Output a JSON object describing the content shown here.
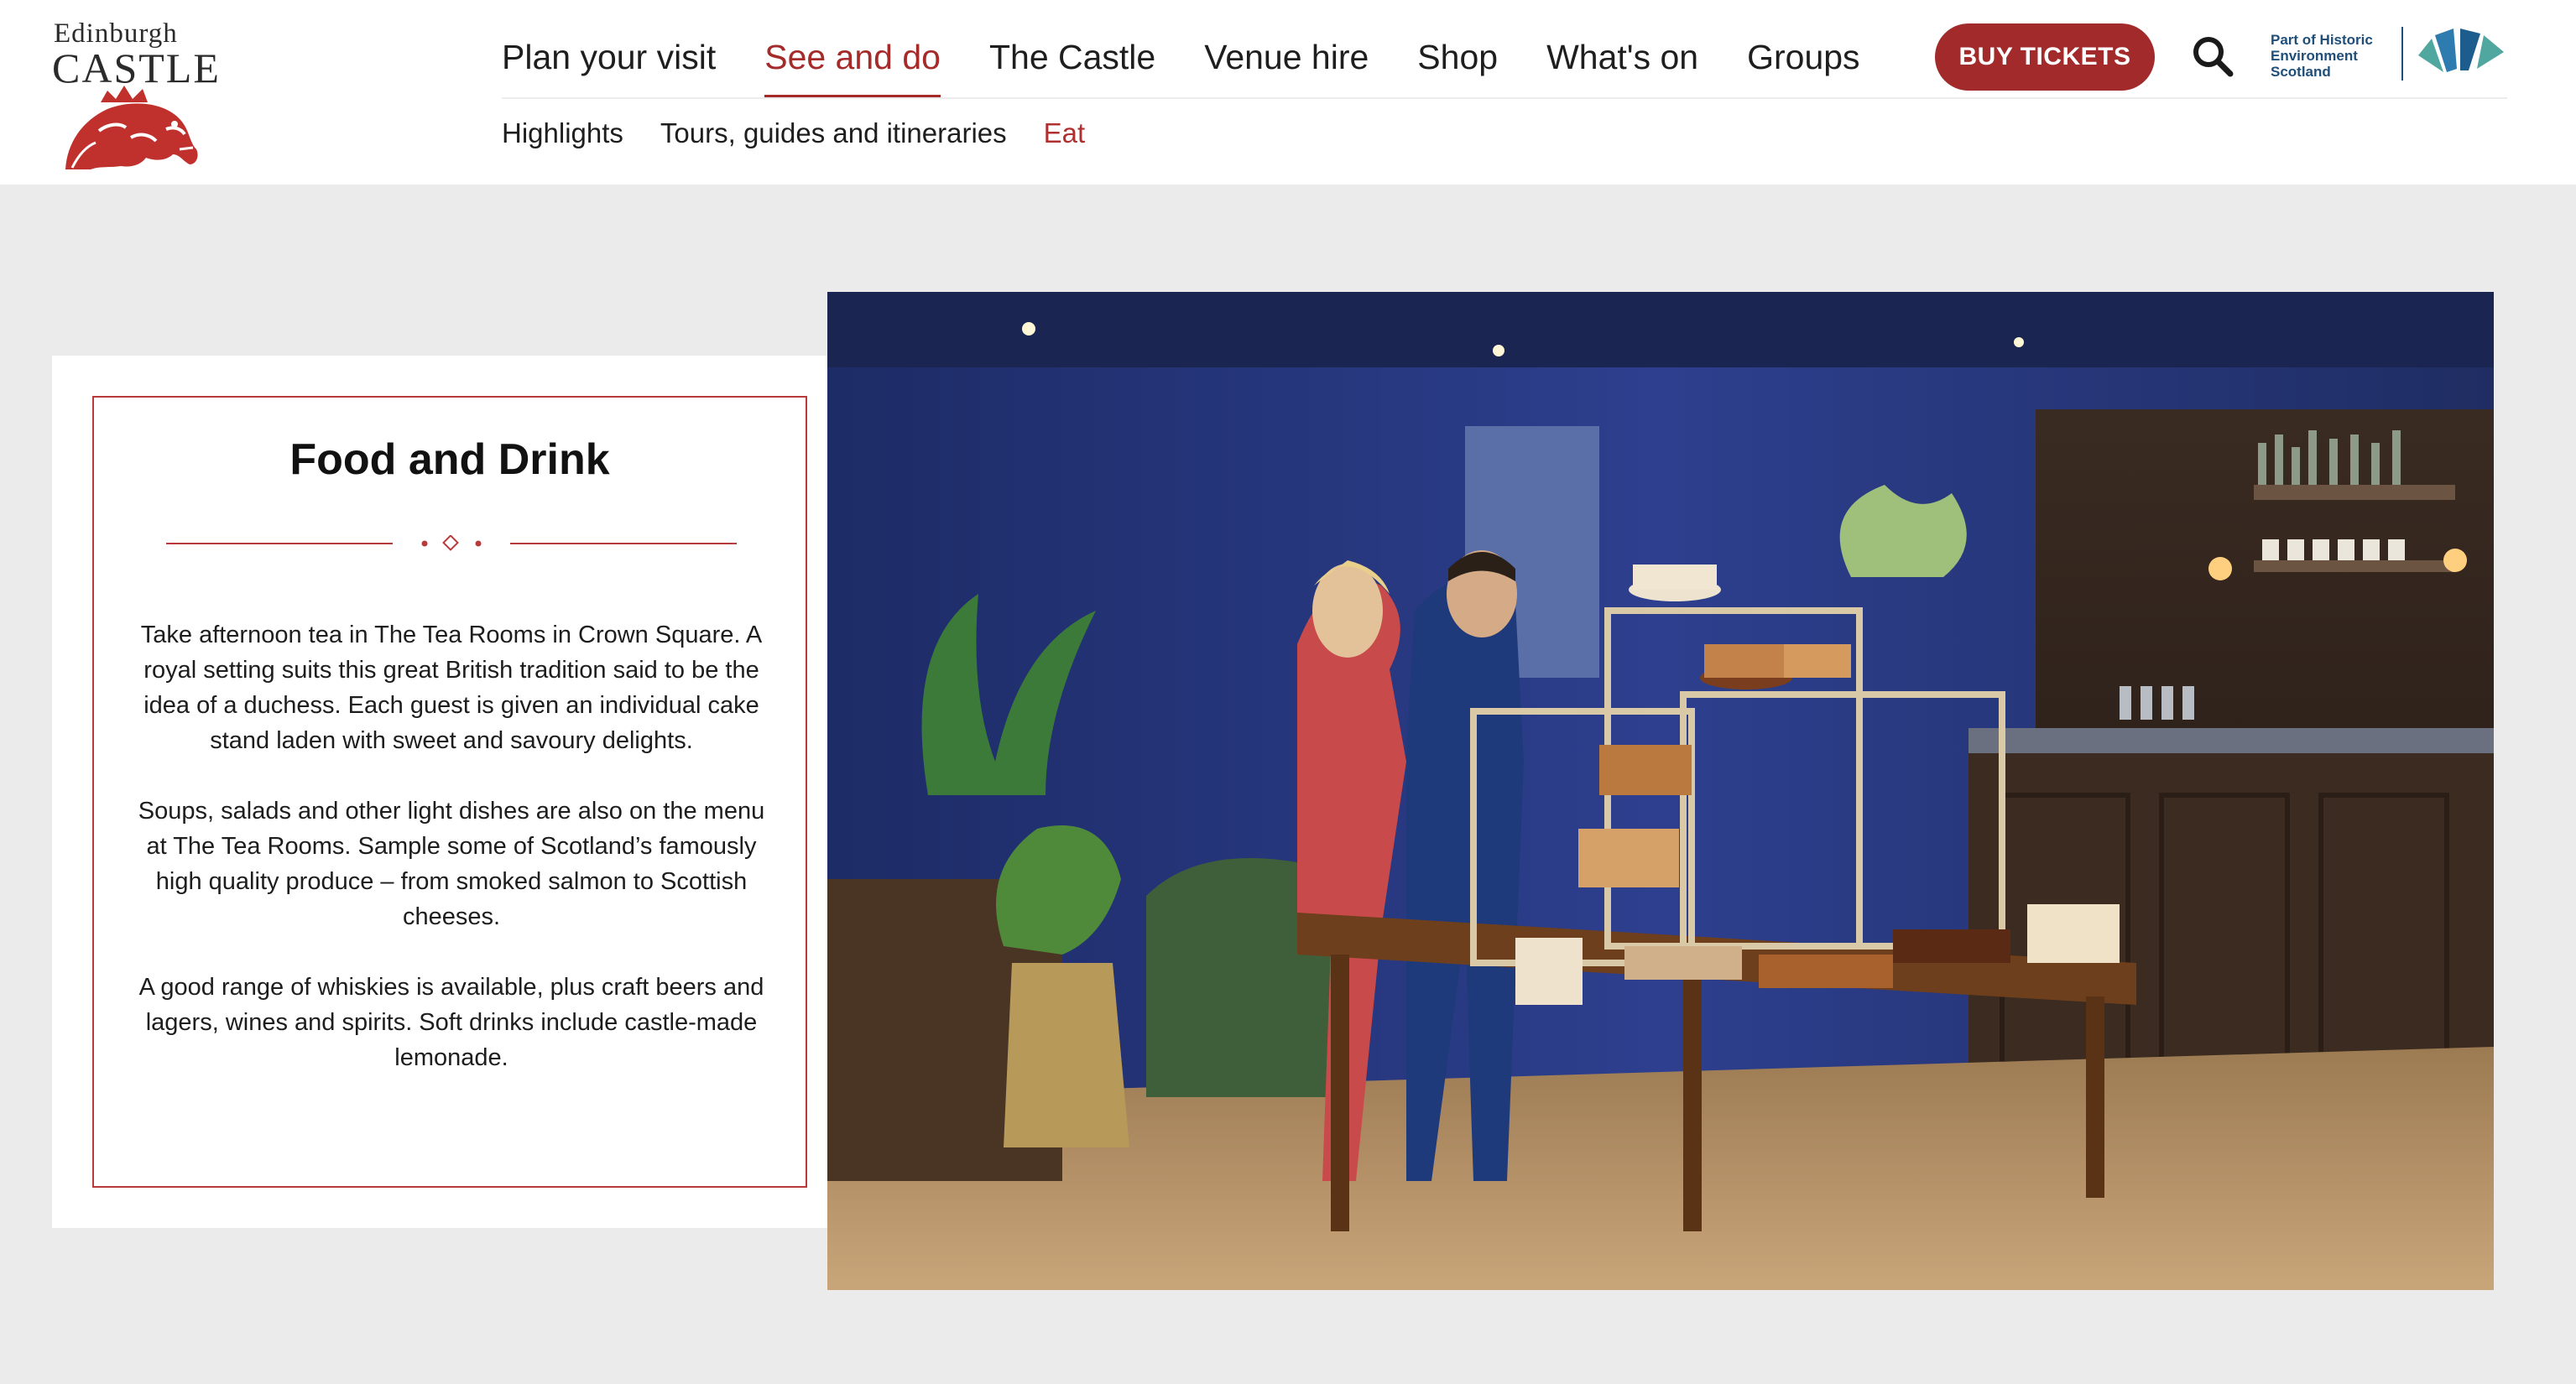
{
  "logo": {
    "word_top": "Edinburgh",
    "word_main": "CASTLE",
    "icon": "lion-crest-icon"
  },
  "nav": {
    "items": [
      {
        "label": "Plan your visit",
        "active": false
      },
      {
        "label": "See and do",
        "active": true
      },
      {
        "label": "The Castle",
        "active": false
      },
      {
        "label": "Venue hire",
        "active": false
      },
      {
        "label": "Shop",
        "active": false
      },
      {
        "label": "What's on",
        "active": false
      },
      {
        "label": "Groups",
        "active": false
      }
    ],
    "buy_label": "BUY TICKETS",
    "search_icon": "search-icon"
  },
  "subnav": {
    "items": [
      {
        "label": "Highlights",
        "active": false
      },
      {
        "label": "Tours, guides and itineraries",
        "active": false
      },
      {
        "label": "Eat",
        "active": true
      }
    ]
  },
  "partner": {
    "lines": [
      "Part of Historic",
      "Environment",
      "Scotland"
    ],
    "icon": "historic-environment-scotland-logo"
  },
  "card": {
    "title": "Food and Drink",
    "paragraphs": [
      "Take afternoon tea in The Tea Rooms in Crown Square. A royal setting suits this great British tradition said to be the idea of a duchess. Each guest is given an individual cake stand laden with sweet and savoury delights.",
      "Soups, salads and other light dishes are also on the menu at The Tea Rooms. Sample some of Scotland’s famously high quality produce – from smoked salmon to Scottish cheeses.",
      "A good range of whiskies is available, plus craft beers and lagers, wines and spirits. Soft drinks include castle-made lemonade."
    ]
  },
  "photo": {
    "subject": "tea-room-photo"
  },
  "colors": {
    "brand_red": "#a32a2a",
    "partner_blue": "#1f4e79",
    "page_bg": "#ebebeb"
  }
}
